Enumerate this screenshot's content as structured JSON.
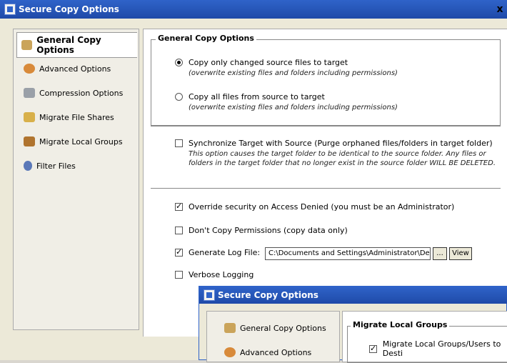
{
  "window": {
    "title": "Secure Copy Options",
    "close_glyph": "x"
  },
  "nav": [
    {
      "label": "General Copy Options",
      "icon": "general-options-icon",
      "active": true
    },
    {
      "label": "Advanced Options",
      "icon": "advanced-options-icon"
    },
    {
      "label": "Compression Options",
      "icon": "compression-icon"
    },
    {
      "label": "Migrate File Shares",
      "icon": "file-shares-icon"
    },
    {
      "label": "Migrate Local Groups",
      "icon": "local-groups-icon"
    },
    {
      "label": "Filter Files",
      "icon": "filter-icon"
    }
  ],
  "main": {
    "group_title": "General Copy Options",
    "radio1": {
      "label": "Copy only changed source files to target",
      "desc": "(overwrite existing files and folders including permissions)",
      "selected": true
    },
    "radio2": {
      "label": "Copy all files from source to target",
      "desc": "(overwrite existing files and folders including permissions)",
      "selected": false
    },
    "sync": {
      "label": "Synchronize Target with Source (Purge orphaned files/folders in target folder)",
      "desc1": "This option causes the target folder to be identical to the source folder.  Any files or",
      "desc2": "folders in the target folder that no longer exist in the source folder WILL BE DELETED.",
      "checked": false
    },
    "override": {
      "label": "Override security on Access Denied (you must be an Administrator)",
      "checked": true
    },
    "dont_copy": {
      "label": "Don't Copy Permissions (copy data only)",
      "checked": false
    },
    "log": {
      "label": "Generate Log File:",
      "checked": true,
      "path": "C:\\Documents and Settings\\Administrator\\Des",
      "browse_label": "...",
      "view_label": "View"
    },
    "verbose": {
      "label": "Verbose Logging",
      "checked": false
    }
  },
  "second_window": {
    "title": "Secure Copy Options",
    "nav": [
      {
        "label": "General Copy Options"
      },
      {
        "label": "Advanced Options"
      }
    ],
    "group_title": "Migrate Local Groups",
    "checkbox_label": "Migrate Local Groups/Users to Desti",
    "checked": true
  }
}
